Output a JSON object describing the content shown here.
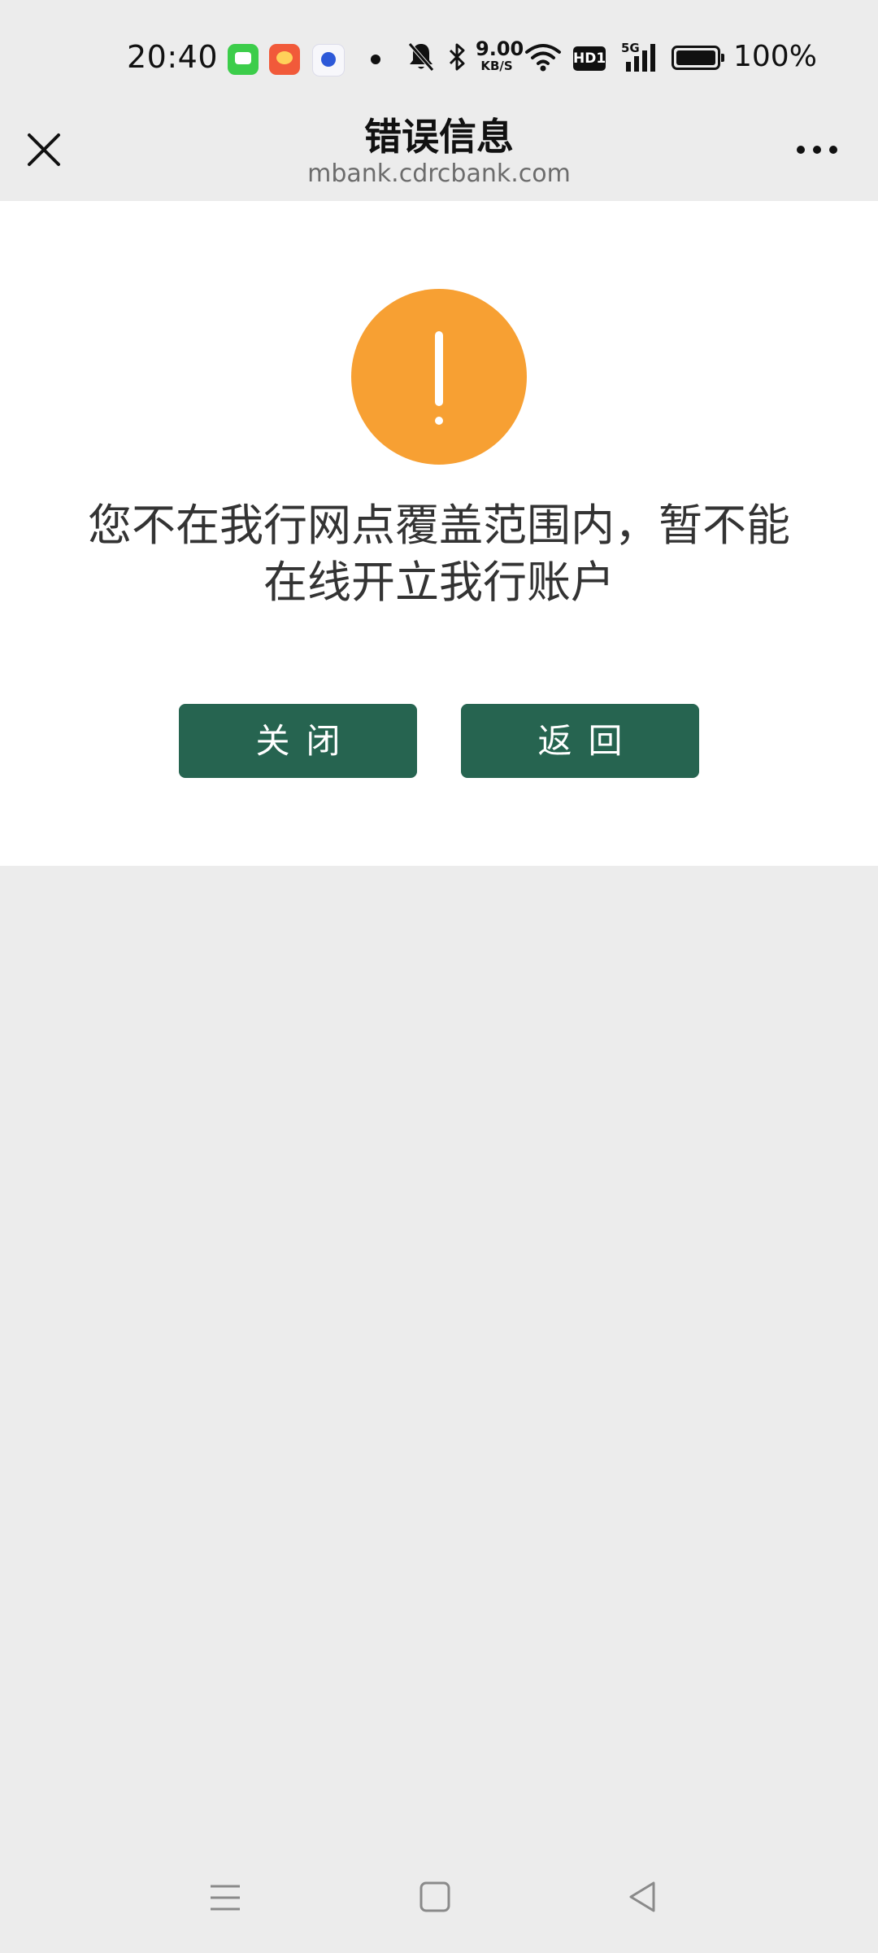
{
  "status_bar": {
    "time": "20:40",
    "network_speed_value": "9.00",
    "network_speed_unit": "KB/S",
    "hd_label": "HD1",
    "network_type": "5G",
    "battery_percent": "100%",
    "icons": [
      "messages-app-icon",
      "game-app-icon",
      "baidu-app-icon",
      "notification-dot",
      "mute-bell-icon",
      "bluetooth-icon",
      "wifi-icon",
      "signal-icon",
      "battery-icon"
    ]
  },
  "nav_bar": {
    "title": "错误信息",
    "url": "mbank.cdrcbank.com",
    "close_icon": "close-icon",
    "more_icon": "more-icon"
  },
  "content": {
    "warning_icon": "warning-exclamation-icon",
    "warning_color": "#f7a033",
    "message_line1": "您不在我行网点覆盖范围内，暂不能",
    "message_line2": "在线开立我行账户",
    "close_button": "关闭",
    "back_button": "返回",
    "button_color": "#266450"
  },
  "system_nav": {
    "icons": [
      "menu-icon",
      "home-icon",
      "back-icon"
    ]
  }
}
